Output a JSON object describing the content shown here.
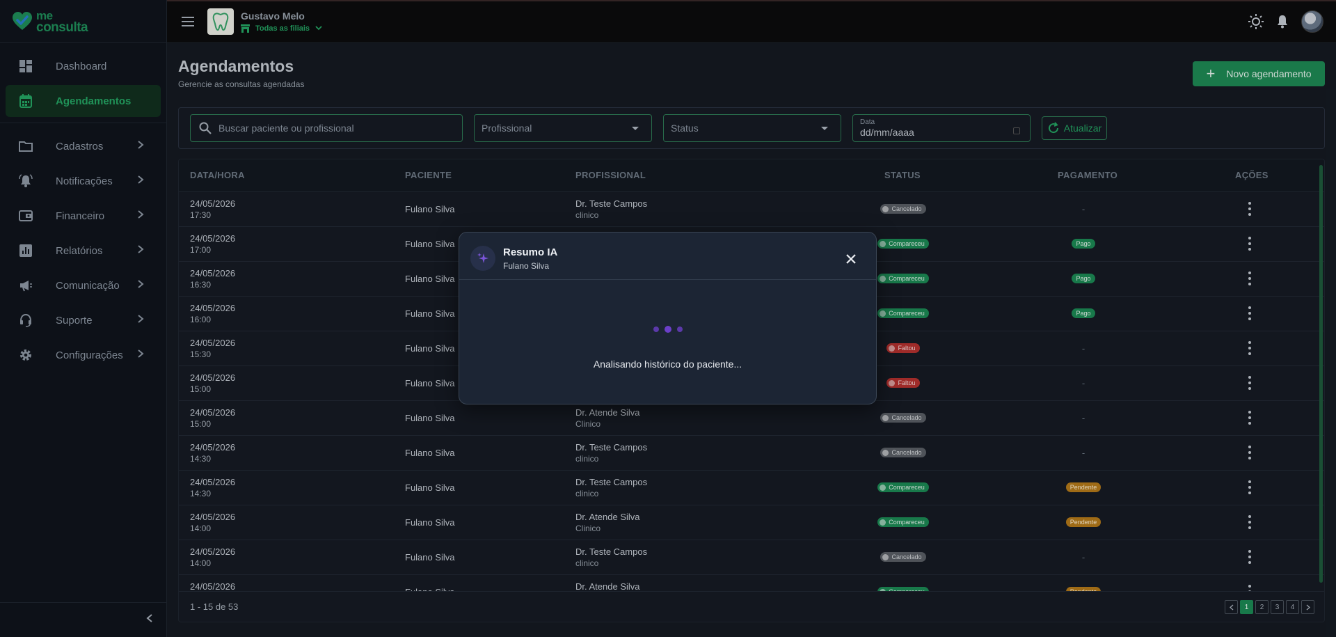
{
  "app": {
    "logo_line1": "me",
    "logo_line2": "consulta"
  },
  "sidebar": {
    "items": [
      {
        "label": "Dashboard",
        "icon": "dashboard-icon"
      },
      {
        "label": "Agendamentos",
        "icon": "calendar-icon",
        "active": true
      },
      {
        "label": "Cadastros",
        "icon": "folder-icon"
      },
      {
        "label": "Notificações",
        "icon": "bell-ring-icon"
      },
      {
        "label": "Financeiro",
        "icon": "wallet-icon"
      },
      {
        "label": "Relatórios",
        "icon": "report-icon"
      },
      {
        "label": "Comunicação",
        "icon": "megaphone-icon"
      },
      {
        "label": "Suporte",
        "icon": "support-icon"
      },
      {
        "label": "Configurações",
        "icon": "gear-icon"
      }
    ]
  },
  "topbar": {
    "user_name": "Gustavo Melo",
    "branch_label": "Todas as filiais"
  },
  "page": {
    "title": "Agendamentos",
    "subtitle": "Gerencie as consultas agendadas",
    "new_button": "Novo agendamento"
  },
  "filters": {
    "search_placeholder": "Buscar paciente ou profissional",
    "professional_label": "Profissional",
    "status_label": "Status",
    "date_label": "Data",
    "date_value": "dd/mm/aaaa",
    "refresh_label": "Atualizar"
  },
  "table": {
    "headers": {
      "date": "DATA/HORA",
      "patient": "PACIENTE",
      "professional": "PROFISSIONAL",
      "status": "STATUS",
      "payment": "PAGAMENTO",
      "actions": "AÇÕES"
    },
    "rows": [
      {
        "date": "24/05/2026",
        "time": "17:30",
        "patient": "Fulano Silva",
        "prof": "Dr. Teste Campos",
        "spec": "clinico",
        "status": "Cancelado",
        "payment": "-"
      },
      {
        "date": "24/05/2026",
        "time": "17:00",
        "patient": "Fulano Silva",
        "prof": "",
        "spec": "",
        "status": "Compareceu",
        "payment": "Pago"
      },
      {
        "date": "24/05/2026",
        "time": "16:30",
        "patient": "Fulano Silva",
        "prof": "",
        "spec": "",
        "status": "Compareceu",
        "payment": "Pago"
      },
      {
        "date": "24/05/2026",
        "time": "16:00",
        "patient": "Fulano Silva",
        "prof": "",
        "spec": "",
        "status": "Compareceu",
        "payment": "Pago"
      },
      {
        "date": "24/05/2026",
        "time": "15:30",
        "patient": "Fulano Silva",
        "prof": "",
        "spec": "",
        "status": "Faltou",
        "payment": "-"
      },
      {
        "date": "24/05/2026",
        "time": "15:00",
        "patient": "Fulano Silva",
        "prof": "",
        "spec": "",
        "status": "Faltou",
        "payment": "-"
      },
      {
        "date": "24/05/2026",
        "time": "15:00",
        "patient": "Fulano Silva",
        "prof": "Dr. Atende Silva",
        "spec": "Clinico",
        "status": "Cancelado",
        "payment": "-"
      },
      {
        "date": "24/05/2026",
        "time": "14:30",
        "patient": "Fulano Silva",
        "prof": "Dr. Teste Campos",
        "spec": "clinico",
        "status": "Cancelado",
        "payment": "-"
      },
      {
        "date": "24/05/2026",
        "time": "14:30",
        "patient": "Fulano Silva",
        "prof": "Dr. Teste Campos",
        "spec": "clinico",
        "status": "Compareceu",
        "payment": "Pendente"
      },
      {
        "date": "24/05/2026",
        "time": "14:00",
        "patient": "Fulano Silva",
        "prof": "Dr. Atende Silva",
        "spec": "Clinico",
        "status": "Compareceu",
        "payment": "Pendente"
      },
      {
        "date": "24/05/2026",
        "time": "14:00",
        "patient": "Fulano Silva",
        "prof": "Dr. Teste Campos",
        "spec": "clinico",
        "status": "Cancelado",
        "payment": "-"
      },
      {
        "date": "24/05/2026",
        "time": "",
        "patient": "Fulano Silva",
        "prof": "Dr. Atende Silva",
        "spec": "",
        "status": "Compareceu",
        "payment": "Pendente"
      }
    ],
    "range_text": "1 - 15 de 53",
    "pages": [
      "1",
      "2",
      "3",
      "4"
    ],
    "current_page": "1"
  },
  "modal": {
    "title": "Resumo IA",
    "subtitle": "Fulano Silva",
    "loading_text": "Analisando histórico do paciente..."
  },
  "colors": {
    "accent": "#1e8a55",
    "danger": "#b6322f",
    "warning": "#b57a1a",
    "ai_purple": "#6b3fc8"
  }
}
